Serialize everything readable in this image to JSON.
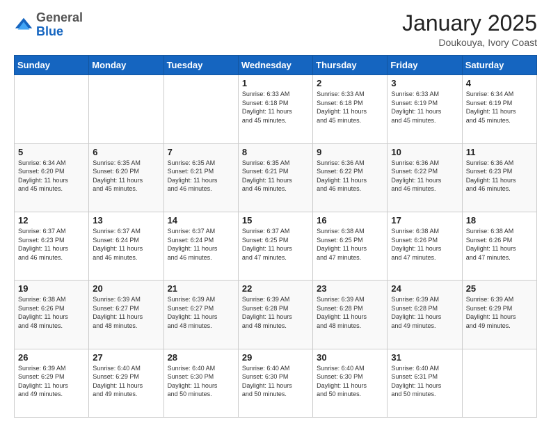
{
  "header": {
    "logo": {
      "general": "General",
      "blue": "Blue"
    },
    "title": "January 2025",
    "subtitle": "Doukouya, Ivory Coast"
  },
  "calendar": {
    "days_of_week": [
      "Sunday",
      "Monday",
      "Tuesday",
      "Wednesday",
      "Thursday",
      "Friday",
      "Saturday"
    ],
    "weeks": [
      [
        {
          "day": "",
          "info": ""
        },
        {
          "day": "",
          "info": ""
        },
        {
          "day": "",
          "info": ""
        },
        {
          "day": "1",
          "info": "Sunrise: 6:33 AM\nSunset: 6:18 PM\nDaylight: 11 hours\nand 45 minutes."
        },
        {
          "day": "2",
          "info": "Sunrise: 6:33 AM\nSunset: 6:18 PM\nDaylight: 11 hours\nand 45 minutes."
        },
        {
          "day": "3",
          "info": "Sunrise: 6:33 AM\nSunset: 6:19 PM\nDaylight: 11 hours\nand 45 minutes."
        },
        {
          "day": "4",
          "info": "Sunrise: 6:34 AM\nSunset: 6:19 PM\nDaylight: 11 hours\nand 45 minutes."
        }
      ],
      [
        {
          "day": "5",
          "info": "Sunrise: 6:34 AM\nSunset: 6:20 PM\nDaylight: 11 hours\nand 45 minutes."
        },
        {
          "day": "6",
          "info": "Sunrise: 6:35 AM\nSunset: 6:20 PM\nDaylight: 11 hours\nand 45 minutes."
        },
        {
          "day": "7",
          "info": "Sunrise: 6:35 AM\nSunset: 6:21 PM\nDaylight: 11 hours\nand 46 minutes."
        },
        {
          "day": "8",
          "info": "Sunrise: 6:35 AM\nSunset: 6:21 PM\nDaylight: 11 hours\nand 46 minutes."
        },
        {
          "day": "9",
          "info": "Sunrise: 6:36 AM\nSunset: 6:22 PM\nDaylight: 11 hours\nand 46 minutes."
        },
        {
          "day": "10",
          "info": "Sunrise: 6:36 AM\nSunset: 6:22 PM\nDaylight: 11 hours\nand 46 minutes."
        },
        {
          "day": "11",
          "info": "Sunrise: 6:36 AM\nSunset: 6:23 PM\nDaylight: 11 hours\nand 46 minutes."
        }
      ],
      [
        {
          "day": "12",
          "info": "Sunrise: 6:37 AM\nSunset: 6:23 PM\nDaylight: 11 hours\nand 46 minutes."
        },
        {
          "day": "13",
          "info": "Sunrise: 6:37 AM\nSunset: 6:24 PM\nDaylight: 11 hours\nand 46 minutes."
        },
        {
          "day": "14",
          "info": "Sunrise: 6:37 AM\nSunset: 6:24 PM\nDaylight: 11 hours\nand 46 minutes."
        },
        {
          "day": "15",
          "info": "Sunrise: 6:37 AM\nSunset: 6:25 PM\nDaylight: 11 hours\nand 47 minutes."
        },
        {
          "day": "16",
          "info": "Sunrise: 6:38 AM\nSunset: 6:25 PM\nDaylight: 11 hours\nand 47 minutes."
        },
        {
          "day": "17",
          "info": "Sunrise: 6:38 AM\nSunset: 6:26 PM\nDaylight: 11 hours\nand 47 minutes."
        },
        {
          "day": "18",
          "info": "Sunrise: 6:38 AM\nSunset: 6:26 PM\nDaylight: 11 hours\nand 47 minutes."
        }
      ],
      [
        {
          "day": "19",
          "info": "Sunrise: 6:38 AM\nSunset: 6:26 PM\nDaylight: 11 hours\nand 48 minutes."
        },
        {
          "day": "20",
          "info": "Sunrise: 6:39 AM\nSunset: 6:27 PM\nDaylight: 11 hours\nand 48 minutes."
        },
        {
          "day": "21",
          "info": "Sunrise: 6:39 AM\nSunset: 6:27 PM\nDaylight: 11 hours\nand 48 minutes."
        },
        {
          "day": "22",
          "info": "Sunrise: 6:39 AM\nSunset: 6:28 PM\nDaylight: 11 hours\nand 48 minutes."
        },
        {
          "day": "23",
          "info": "Sunrise: 6:39 AM\nSunset: 6:28 PM\nDaylight: 11 hours\nand 48 minutes."
        },
        {
          "day": "24",
          "info": "Sunrise: 6:39 AM\nSunset: 6:28 PM\nDaylight: 11 hours\nand 49 minutes."
        },
        {
          "day": "25",
          "info": "Sunrise: 6:39 AM\nSunset: 6:29 PM\nDaylight: 11 hours\nand 49 minutes."
        }
      ],
      [
        {
          "day": "26",
          "info": "Sunrise: 6:39 AM\nSunset: 6:29 PM\nDaylight: 11 hours\nand 49 minutes."
        },
        {
          "day": "27",
          "info": "Sunrise: 6:40 AM\nSunset: 6:29 PM\nDaylight: 11 hours\nand 49 minutes."
        },
        {
          "day": "28",
          "info": "Sunrise: 6:40 AM\nSunset: 6:30 PM\nDaylight: 11 hours\nand 50 minutes."
        },
        {
          "day": "29",
          "info": "Sunrise: 6:40 AM\nSunset: 6:30 PM\nDaylight: 11 hours\nand 50 minutes."
        },
        {
          "day": "30",
          "info": "Sunrise: 6:40 AM\nSunset: 6:30 PM\nDaylight: 11 hours\nand 50 minutes."
        },
        {
          "day": "31",
          "info": "Sunrise: 6:40 AM\nSunset: 6:31 PM\nDaylight: 11 hours\nand 50 minutes."
        },
        {
          "day": "",
          "info": ""
        }
      ]
    ]
  }
}
